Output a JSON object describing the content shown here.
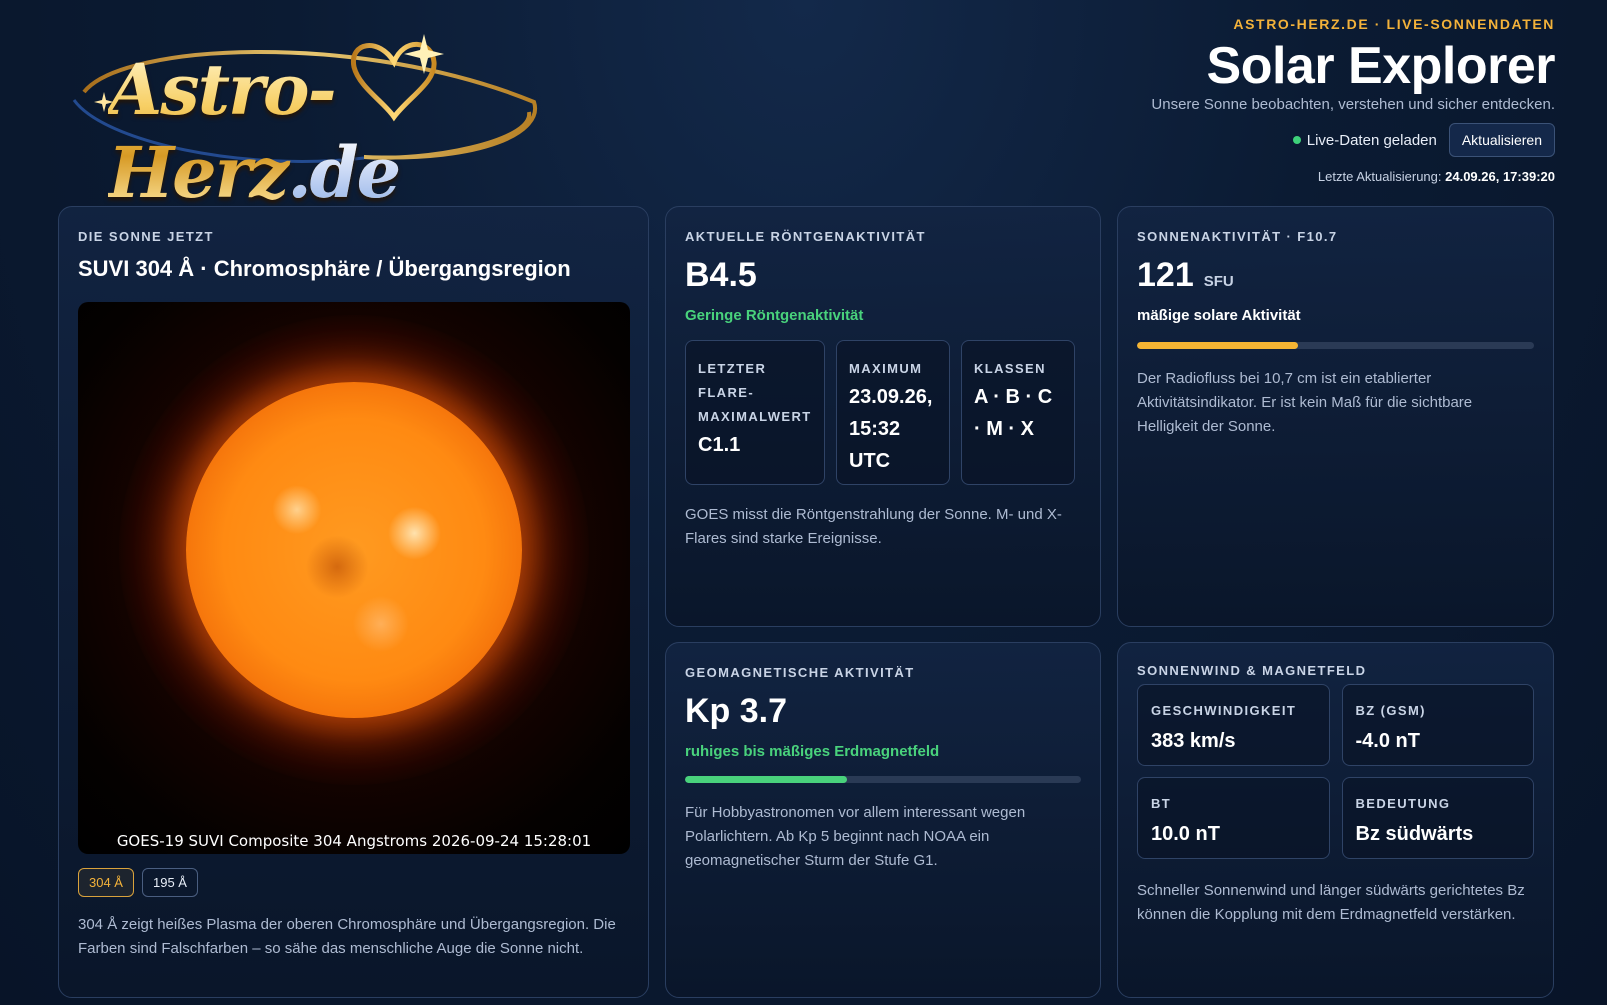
{
  "header": {
    "logo_main": "Astro-Herz",
    "logo_suffix": ".de",
    "eyebrow": "ASTRO-HERZ.DE · LIVE-SONNENDATEN",
    "title": "Solar Explorer",
    "subtitle": "Unsere Sonne beobachten, verstehen und sicher entdecken.",
    "live_status": "Live-Daten geladen",
    "refresh_label": "Aktualisieren",
    "last_update_label": "Letzte Aktualisierung:",
    "last_update_value": "24.09.26, 17:39:20"
  },
  "sun": {
    "label": "DIE SONNE JETZT",
    "title": "SUVI 304 Å · Chromosphäre / Übergangsregion",
    "caption": "GOES-19 SUVI Composite 304 Angstroms 2026-09-24 15:28:01",
    "wavelengths": [
      {
        "label": "304 Å",
        "active": true
      },
      {
        "label": "195 Å",
        "active": false
      }
    ],
    "description": "304 Å zeigt heißes Plasma der oberen Chromosphäre und Übergangsregion. Die Farben sind Falschfarben – so sähe das menschliche Auge die Sonne nicht."
  },
  "xray": {
    "label": "AKTUELLE RÖNTGENAKTIVITÄT",
    "value": "B4.5",
    "status": "Geringe Röntgenaktivität",
    "stats": [
      {
        "label": "LETZTER FLARE-MAXIMALWERT",
        "value": "C1.1"
      },
      {
        "label": "MAXIMUM",
        "value": "23.09.26, 15:32 UTC"
      },
      {
        "label": "KLASSEN",
        "value": "A · B · C · M · X"
      }
    ],
    "description": "GOES misst die Röntgenstrahlung der Sonne. M- und X-Flares sind starke Ereignisse."
  },
  "f107": {
    "label": "SONNENAKTIVITÄT · F10.7",
    "value": "121",
    "unit": "SFU",
    "status": "mäßige solare Aktivität",
    "bar_fraction": 0.405,
    "bar_color": "#f5b433",
    "description": "Der Radiofluss bei 10,7 cm ist ein etablierter Aktivitätsindikator. Er ist kein Maß für die sichtbare Helligkeit der Sonne."
  },
  "geo": {
    "label": "GEOMAGNETISCHE AKTIVITÄT",
    "value": "Kp 3.7",
    "status": "ruhiges bis mäßiges Erdmagnetfeld",
    "bar_fraction": 0.41,
    "bar_color": "#49d27c",
    "description": "Für Hobbyastronomen vor allem interessant wegen Polarlichtern. Ab Kp 5 beginnt nach NOAA ein geomagnetischer Sturm der Stufe G1."
  },
  "wind": {
    "label": "SONNENWIND & MAGNETFELD",
    "stats": [
      {
        "label": "GESCHWINDIGKEIT",
        "value": "383 km/s"
      },
      {
        "label": "BZ (GSM)",
        "value": "-4.0 nT"
      },
      {
        "label": "BT",
        "value": "10.0 nT"
      },
      {
        "label": "BEDEUTUNG",
        "value": "Bz südwärts"
      }
    ],
    "description": "Schneller Sonnenwind und länger südwärts gerichtetes Bz können die Kopplung mit dem Erdmagnetfeld verstärken."
  },
  "colors": {
    "accent_gold": "#f3b23a",
    "status_green": "#49d27c",
    "background": "#0b1b33"
  }
}
